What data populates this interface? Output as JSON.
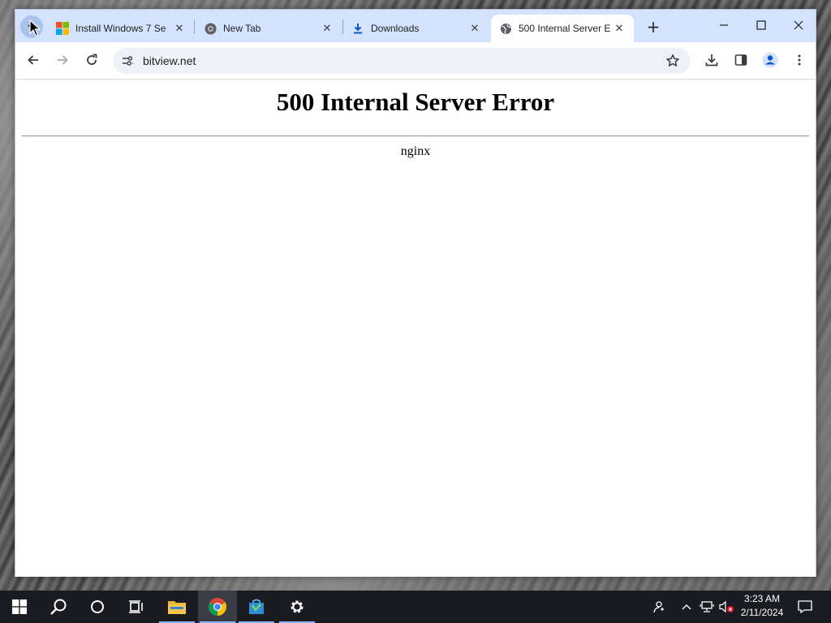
{
  "browser": {
    "tabs": [
      {
        "title": "Install Windows 7 Se",
        "favicon": "microsoft-logo",
        "active": false
      },
      {
        "title": "New Tab",
        "favicon": "chrome-logo",
        "active": false
      },
      {
        "title": "Downloads",
        "favicon": "download-icon",
        "active": false
      },
      {
        "title": "500 Internal Server E",
        "favicon": "globe-icon",
        "active": true
      }
    ],
    "new_tab_label": "+",
    "url": "bitview.net"
  },
  "page": {
    "heading": "500 Internal Server Error",
    "server": "nginx"
  },
  "taskbar": {
    "items": [
      "windows-start",
      "search",
      "cortana",
      "task-view",
      "file-explorer",
      "chrome",
      "app-store-bag",
      "settings"
    ],
    "clock": {
      "time": "3:23 AM",
      "date": "2/11/2024"
    }
  },
  "colors": {
    "tabstrip": "#d3e3fd",
    "accent": "#0b57d0",
    "taskbar": "#1a1c22"
  }
}
